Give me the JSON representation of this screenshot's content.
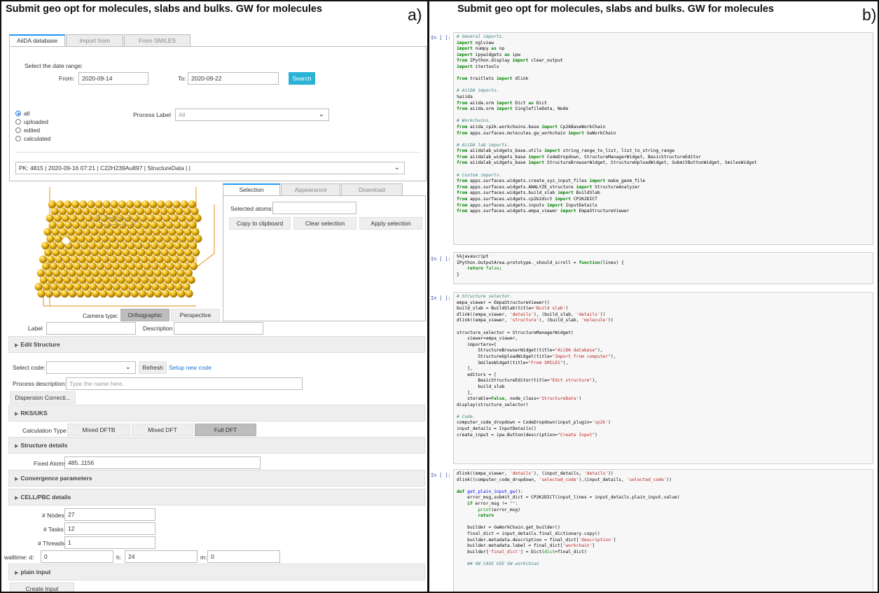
{
  "panel_a": {
    "title": "Submit geo opt for molecules, slabs and bulks. GW for molecules",
    "letter": "a)",
    "tabs": [
      "AiiDA database",
      "Import from computer",
      "From SMILES"
    ],
    "date_range_label": "Select the date range:",
    "from_label": "From:",
    "from_value": "2020-09-14",
    "to_label": "To:",
    "to_value": "2020-09-22",
    "search_label": "Search",
    "radios": [
      "all",
      "uploaded",
      "edited",
      "calculated"
    ],
    "process_label": "Process Label",
    "process_value": "All",
    "structure_value": "PK: 4815 | 2020-09-16 07:21 | C22H239Au897 | StructureData |  |",
    "viewer_tabs": [
      "Selection",
      "Appearance",
      "Download"
    ],
    "selected_atoms_label": "Selected atoms:",
    "copy_label": "Copy to clipboard",
    "clear_label": "Clear selection",
    "apply_label": "Apply selection",
    "camera_label": "Camera type:",
    "orthographic": "Orthographic",
    "perspective": "Perspective",
    "label_label": "Label",
    "description_label": "Description",
    "edit_structure": "Edit Structure",
    "select_code_label": "Select code:",
    "refresh_label": "Refresh",
    "setup_code_label": "Setup new code",
    "process_desc_label": "Process description:",
    "process_desc_placeholder": "Type the name here.",
    "dispersion_label": "Dispersion Correcti...",
    "rks_uks": "RKS/UKS",
    "calc_type_label": "Calculation Type",
    "calc_types": [
      "Mixed DFTB",
      "Mixed DFT",
      "Full DFT"
    ],
    "structure_details": "Structure details",
    "fixed_atoms_label": "Fixed Atoms",
    "fixed_atoms_value": "485..1156",
    "convergence": "Convergence parameters",
    "cell_pbc": "CELL/PBC details",
    "nodes_label": "# Nodes",
    "nodes_value": "27",
    "tasks_label": "# Tasks",
    "tasks_value": "12",
    "threads_label": "# Threads",
    "threads_value": "1",
    "walltime_label": "walltime: d:",
    "walltime_d": "0",
    "h_label": "h:",
    "walltime_h": "24",
    "m_label": "m:",
    "walltime_m": "0",
    "plain_input": "plain input",
    "create_input_label": "Create Input"
  },
  "panel_b": {
    "title": "Submit geo opt for molecules, slabs and bulks. GW for molecules",
    "letter": "b)",
    "prompt": "In [ ]:"
  },
  "icons": {
    "chevron": "chevron-down-icon",
    "caret": "caret-right-icon"
  },
  "colors": {
    "accent_blue": "#2196f3",
    "search_button": "#2bb3d6",
    "gold_atoms": "#e0a800",
    "cell_bg": "#f7f7f7"
  }
}
